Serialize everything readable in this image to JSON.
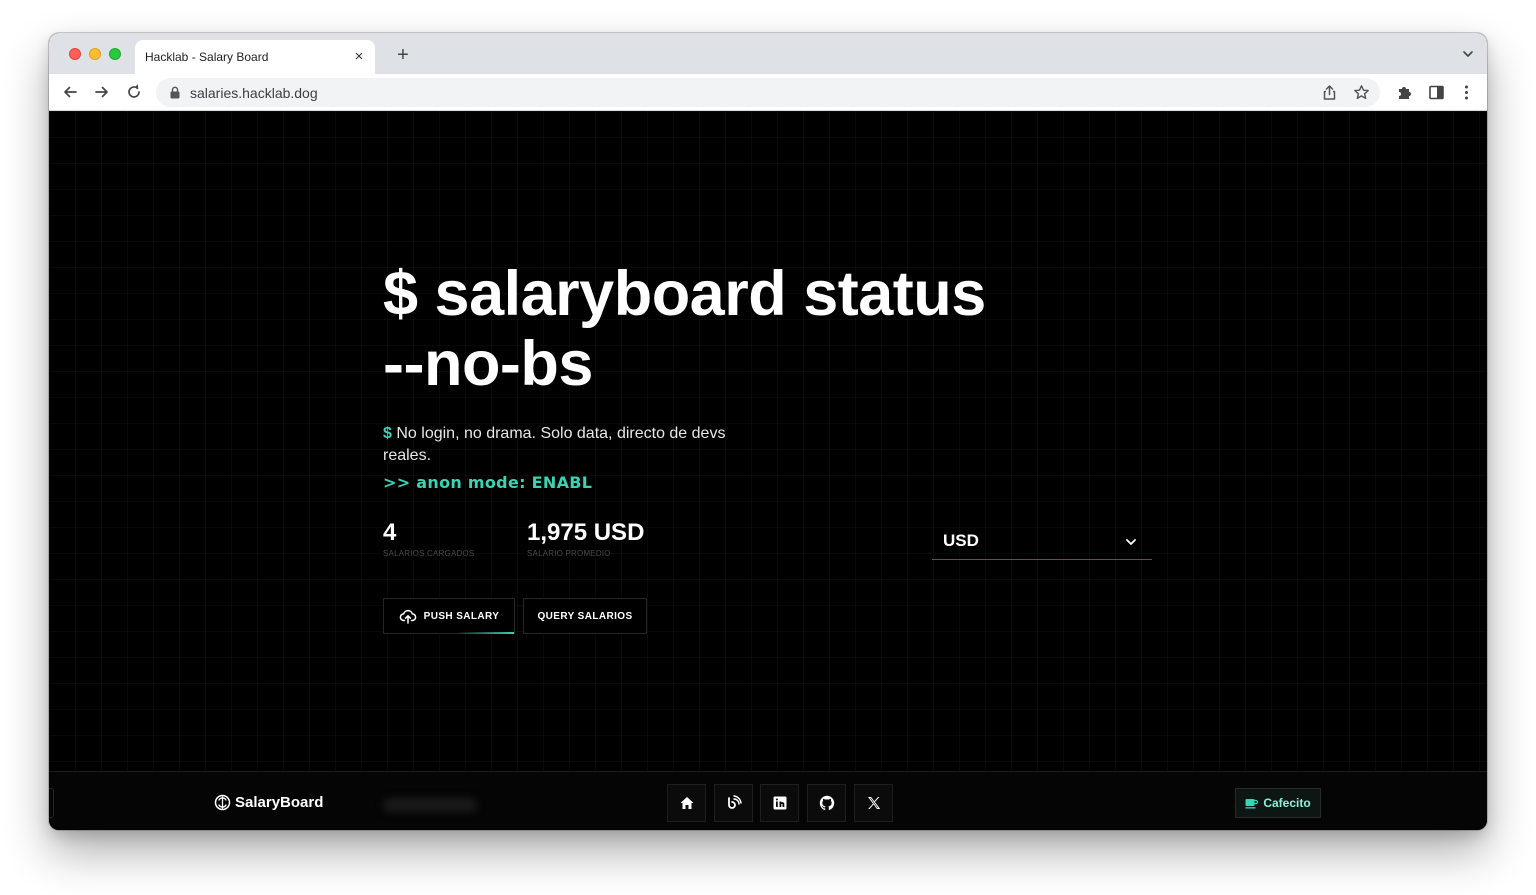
{
  "browser": {
    "tab_title": "Hacklab - Salary Board",
    "url": "salaries.hacklab.dog"
  },
  "hero": {
    "title_line1": "$ salaryboard status",
    "title_line2": "--no-bs",
    "tagline_prefix": "$",
    "tagline": "No login, no drama. Solo data, directo de devs reales.",
    "anon_mode": ">> anon mode: ENABL"
  },
  "stats": {
    "count_value": "4",
    "count_label": "SALARIOS CARGADOS",
    "avg_value": "1,975 USD",
    "avg_label": "SALARIO PROMEDIO"
  },
  "currency": {
    "selected": "USD"
  },
  "actions": {
    "push_label": "PUSH SALARY",
    "query_label": "QUERY SALARIOS"
  },
  "footer": {
    "brand": "SalaryBoard",
    "social_icons": [
      "home-icon",
      "blog-icon",
      "linkedin-icon",
      "github-icon",
      "x-icon"
    ],
    "cafecito_label": "Cafecito"
  },
  "colors": {
    "accent": "#3fd1b3",
    "background": "#000000"
  }
}
